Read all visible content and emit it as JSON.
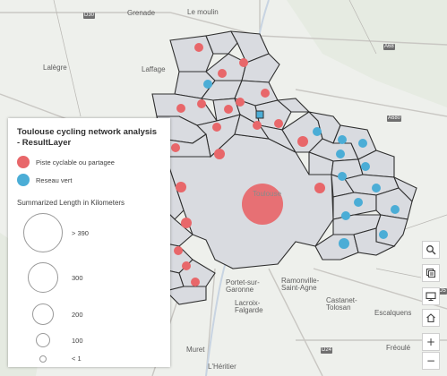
{
  "legend": {
    "title": "Toulouse cycling network analysis - ResultLayer",
    "categories": [
      {
        "label": "Piste cyclable ou partagee",
        "color": "#e8676a"
      },
      {
        "label": "Reseau vert",
        "color": "#4badd6"
      }
    ],
    "size_title": "Summarized Length in Kilometers",
    "sizes": [
      "> 390",
      "300",
      "200",
      "100",
      "< 1"
    ]
  },
  "places": {
    "grenade": "Grenade",
    "le_moulin": "Le moulin",
    "d30": "D30",
    "a68": "A68",
    "lalegre": "Lalègre",
    "laffage": "Laffage",
    "a680": "A680",
    "toulouse": "Toulouse",
    "ramonville": "Ramonville-Saint-Agne",
    "portet": "Portet-sur-Garonne",
    "lacroix": "Lacroix-Falgarde",
    "castanet": "Castanet-Tolosan",
    "escalquens": "Escalquens",
    "muret": "Muret",
    "lheritier": "L'Héritier",
    "freoule": "Fréoulé",
    "d24": "D24",
    "d5": "D5"
  },
  "toolbar": {
    "search_icon": "search-icon",
    "layers_icon": "layers-icon",
    "screen_icon": "screen-icon",
    "home_icon": "home-icon",
    "zoom_in": "+",
    "zoom_out": "−"
  },
  "colors": {
    "red": "#e8676a",
    "blue": "#4badd6",
    "district_fill": "#d9dbe0",
    "outline": "#333333"
  }
}
